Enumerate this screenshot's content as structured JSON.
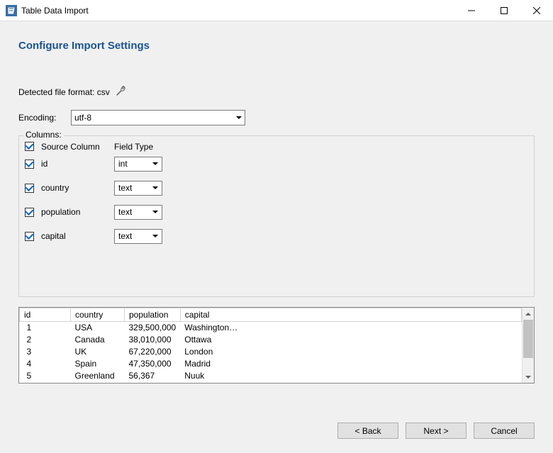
{
  "window": {
    "title": "Table Data Import"
  },
  "heading": "Configure Import Settings",
  "detected_label": "Detected file format: csv",
  "encoding_label": "Encoding:",
  "encoding_value": "utf-8",
  "columns_legend": "Columns:",
  "columns_header_source": "Source Column",
  "columns_header_type": "Field Type",
  "columns": [
    {
      "name": "id",
      "type": "int"
    },
    {
      "name": "country",
      "type": "text"
    },
    {
      "name": "population",
      "type": "text"
    },
    {
      "name": "capital",
      "type": "text"
    }
  ],
  "preview": {
    "headers": [
      "id",
      "country",
      "population",
      "capital"
    ],
    "rows": [
      [
        "1",
        "USA",
        "329,500,000",
        "Washington…"
      ],
      [
        "2",
        "Canada",
        "38,010,000",
        "Ottawa"
      ],
      [
        "3",
        "UK",
        "67,220,000",
        "London"
      ],
      [
        "4",
        "Spain",
        "47,350,000",
        "Madrid"
      ],
      [
        "5",
        "Greenland",
        "56,367",
        "Nuuk"
      ]
    ]
  },
  "buttons": {
    "back": "< Back",
    "next": "Next >",
    "cancel": "Cancel"
  }
}
